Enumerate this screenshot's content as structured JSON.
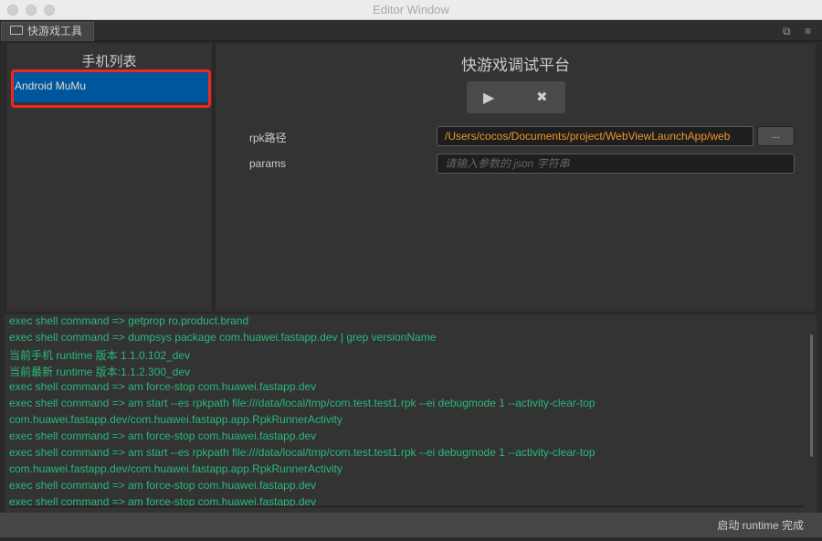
{
  "window": {
    "title": "Editor Window"
  },
  "tab": {
    "label": "快游戏工具",
    "icon": "panel-icon"
  },
  "tab_actions": {
    "popout_icon": "popout-icon",
    "menu_icon": "menu-icon"
  },
  "devices": {
    "title": "手机列表",
    "items": [
      {
        "label": "Android MuMu",
        "selected": true
      }
    ],
    "highlight_color": "#f0281e",
    "selected_color": "#00569a"
  },
  "main": {
    "title": "快游戏调试平台",
    "play_icon": "play-icon",
    "stop_icon": "close-icon",
    "rpk_label": "rpk路径",
    "rpk_value": "/Users/cocos/Documents/project/WebViewLaunchApp/web",
    "browse_label": "...",
    "params_label": "params",
    "params_placeholder": "请输入参数的 json 字符串",
    "path_color": "#f0962a"
  },
  "log": {
    "color": "#29b979",
    "lines": [
      "exec shell command => getprop ro.product.brand",
      "exec shell command => dumpsys package com.huawei.fastapp.dev | grep versionName",
      "当前手机 runtime 版本 1.1.0.102_dev",
      "当前最新 runtime 版本:1.1.2.300_dev",
      "exec shell command => am force-stop com.huawei.fastapp.dev",
      "exec shell command => am start --es rpkpath file:///data/local/tmp/com.test.test1.rpk --ei debugmode 1 --activity-clear-top",
      "com.huawei.fastapp.dev/com.huawei.fastapp.app.RpkRunnerActivity",
      "exec shell command => am force-stop com.huawei.fastapp.dev",
      "exec shell command => am start --es rpkpath file:///data/local/tmp/com.test.test1.rpk --ei debugmode 1 --activity-clear-top",
      "com.huawei.fastapp.dev/com.huawei.fastapp.app.RpkRunnerActivity",
      "exec shell command => am force-stop com.huawei.fastapp.dev",
      "exec shell command => am force-stop com.huawei.fastapp.dev"
    ]
  },
  "status": {
    "text": "启动 runtime 完成"
  }
}
